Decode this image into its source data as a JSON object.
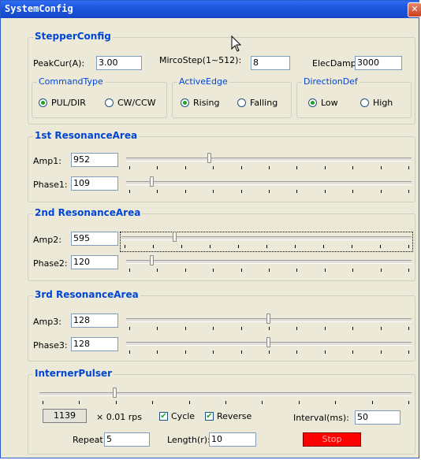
{
  "window": {
    "title": "SystemConfig",
    "close_glyph": "✕"
  },
  "stepper": {
    "legend": "StepperConfig",
    "peakcur_label": "PeakCur(A):",
    "peakcur_value": "3.00",
    "microstep_label": "MircoStep(1~512):",
    "microstep_value": "8",
    "elecdamp_label": "ElecDamp:",
    "elecdamp_value": "3000",
    "command_type": {
      "legend": "CommandType",
      "opt1": "PUL/DIR",
      "opt2": "CW/CCW",
      "selected": "PUL/DIR"
    },
    "active_edge": {
      "legend": "ActiveEdge",
      "opt1": "Rising",
      "opt2": "Falling",
      "selected": "Rising"
    },
    "direction_def": {
      "legend": "DirectionDef",
      "opt1": "Low",
      "opt2": "High",
      "selected": "Low"
    }
  },
  "resonance": [
    {
      "legend": "1st ResonanceArea",
      "amp_label": "Amp1:",
      "amp_value": "952",
      "phase_label": "Phase1:",
      "phase_value": "109",
      "amp_level": 0.29,
      "phase_level": 0.085
    },
    {
      "legend": "2nd ResonanceArea",
      "amp_label": "Amp2:",
      "amp_value": "595",
      "phase_label": "Phase2:",
      "phase_value": "120",
      "amp_level": 0.18,
      "phase_level": 0.085
    },
    {
      "legend": "3rd ResonanceArea",
      "amp_label": "Amp3:",
      "amp_value": "128",
      "phase_label": "Phase3:",
      "phase_value": "128",
      "amp_level": 0.5,
      "phase_level": 0.5
    }
  ],
  "pulser": {
    "legend": "InternerPulser",
    "speed_value": "1139",
    "speed_unit": "× 0.01 rps",
    "cycle_label": "Cycle",
    "cycle_checked": true,
    "reverse_label": "Reverse",
    "reverse_checked": true,
    "interval_label": "Interval(ms):",
    "interval_value": "50",
    "repeat_label": "Repeat:",
    "repeat_value": "5",
    "length_label": "Length(r):",
    "length_value": "10",
    "stop_label": "Stop",
    "slider_level": 0.2
  },
  "colors": {
    "title_bar": "#1d56de",
    "legend": "#0046d5",
    "stop_button": "#ff0000"
  }
}
